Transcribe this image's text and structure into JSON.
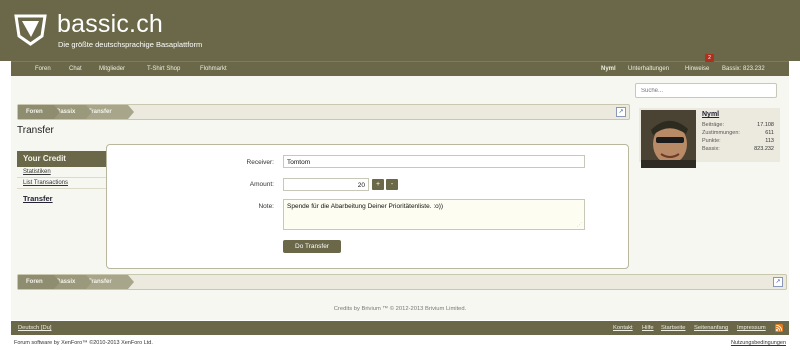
{
  "header": {
    "title": "bassic.ch",
    "subtitle": "Die größte deutschsprachige Basaplattform"
  },
  "nav": {
    "items": [
      "Foren",
      "Chat",
      "Mitglieder",
      "T-Shirt Shop",
      "Flohmarkt"
    ],
    "right": {
      "user": "Nyml",
      "conversations": "Unterhaltungen",
      "alerts": "Hinweise",
      "alerts_badge": "2",
      "balance": "Bassix: 823.232"
    }
  },
  "search": {
    "placeholder": "Suche..."
  },
  "breadcrumb": [
    "Foren",
    "Bassix",
    "Transfer"
  ],
  "page_title": "Transfer",
  "credit_panel": {
    "heading": "Your Credit",
    "items": [
      "Statistiken",
      "List Transactions",
      "Transfer"
    ]
  },
  "form": {
    "receiver_label": "Receiver:",
    "receiver_value": "Tomtom",
    "amount_label": "Amount:",
    "amount_value": "20",
    "plus_label": "+",
    "minus_label": "-",
    "note_label": "Note:",
    "note_value": "Spende für die Abarbeitung Deiner Prioritätenliste. :o))",
    "submit_label": "Do Transfer"
  },
  "profile": {
    "name": "Nyml",
    "stats": [
      {
        "label": "Beiträge:",
        "value": "17.108"
      },
      {
        "label": "Zustimmungen:",
        "value": "611"
      },
      {
        "label": "Punkte:",
        "value": "113"
      },
      {
        "label": "Bassix:",
        "value": "823.232"
      }
    ]
  },
  "credits_line": "Credits by Brivium ™ © 2012-2013 Brivium Limited.",
  "footer": {
    "language": "Deutsch [Du]",
    "links": [
      "Kontakt",
      "Hilfe",
      "Startseite",
      "Seitenanfang",
      "Impressum"
    ]
  },
  "copyright": "Forum software by XenForo™ ©2010-2013 XenForo Ltd.",
  "terms": "Nutzungsbedingungen",
  "colors": {
    "brand": "#6a6848",
    "panel": "#eceade",
    "crumb": "#8f8d6f"
  },
  "icons": [
    "logo-shield-icon",
    "jump-link-icon",
    "rss-icon",
    "textarea-resize-icon"
  ]
}
